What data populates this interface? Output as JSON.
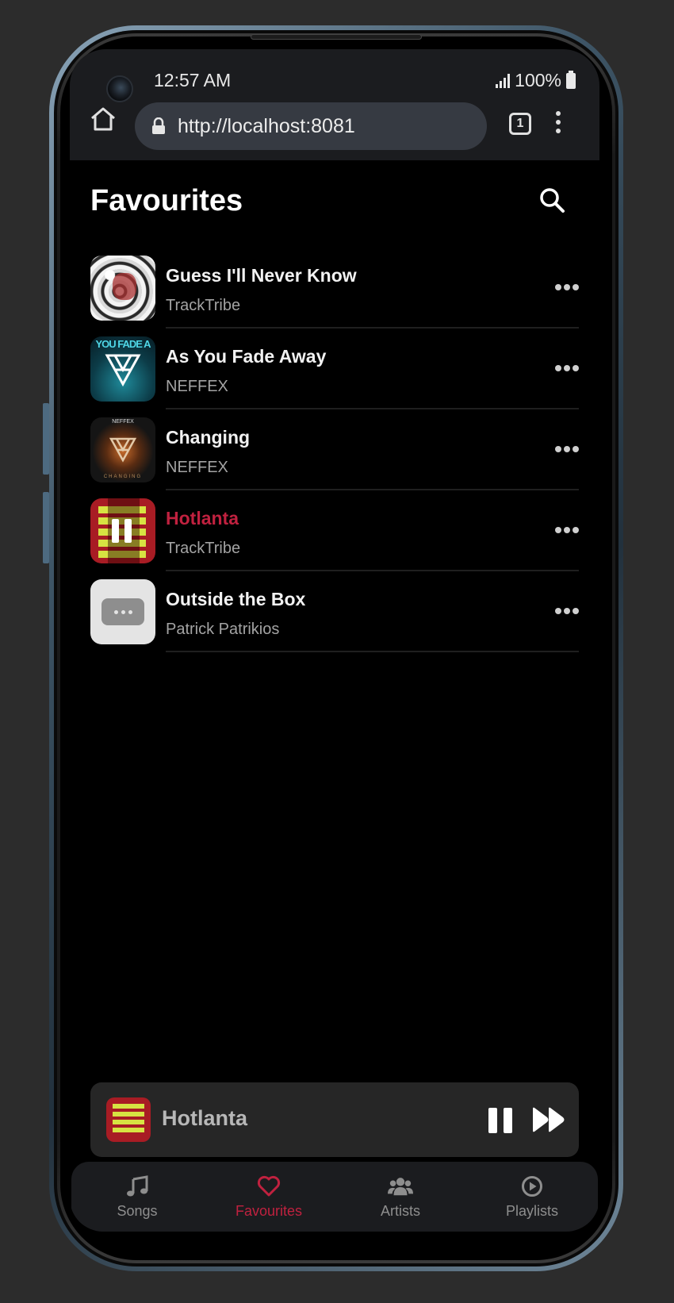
{
  "status": {
    "time": "12:57 AM",
    "battery": "100%"
  },
  "browser": {
    "url": "http://localhost:8081",
    "tab_count": "1"
  },
  "page": {
    "title": "Favourites"
  },
  "songs": [
    {
      "title": "Guess I'll Never Know",
      "artist": "TrackTribe",
      "active": false
    },
    {
      "title": "As You Fade Away",
      "artist": "NEFFEX",
      "active": false,
      "art_text": "YOU FADE A"
    },
    {
      "title": "Changing",
      "artist": "NEFFEX",
      "active": false,
      "art_text_top": "NEFFEX",
      "art_text_bottom": "CHANGING"
    },
    {
      "title": "Hotlanta",
      "artist": "TrackTribe",
      "active": true
    },
    {
      "title": "Outside the Box",
      "artist": "Patrick Patrikios",
      "active": false
    }
  ],
  "now_playing": {
    "title": "Hotlanta"
  },
  "tabs": [
    {
      "label": "Songs",
      "icon": "music-note-icon",
      "active": false
    },
    {
      "label": "Favourites",
      "icon": "heart-icon",
      "active": true
    },
    {
      "label": "Artists",
      "icon": "users-icon",
      "active": false
    },
    {
      "label": "Playlists",
      "icon": "play-circle-icon",
      "active": false
    }
  ],
  "colors": {
    "accent": "#c0213f",
    "background": "#000000",
    "bar": "#1b1c1f",
    "player": "#262626"
  }
}
